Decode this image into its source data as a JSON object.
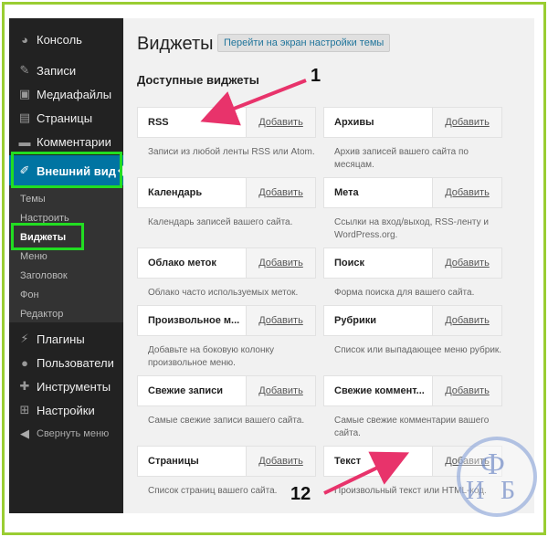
{
  "sidebar": {
    "items": [
      {
        "label": "Консоль",
        "icon": "dashboard-icon"
      },
      {
        "label": "Записи",
        "icon": "pin-icon"
      },
      {
        "label": "Медиафайлы",
        "icon": "media-icon"
      },
      {
        "label": "Страницы",
        "icon": "page-icon"
      },
      {
        "label": "Комментарии",
        "icon": "comment-icon"
      },
      {
        "label": "Внешний вид",
        "icon": "brush-icon"
      },
      {
        "label": "Плагины",
        "icon": "plugin-icon"
      },
      {
        "label": "Пользователи",
        "icon": "users-icon"
      },
      {
        "label": "Инструменты",
        "icon": "wrench-icon"
      },
      {
        "label": "Настройки",
        "icon": "settings-icon"
      }
    ],
    "submenu": [
      "Темы",
      "Настроить",
      "Виджеты",
      "Меню",
      "Заголовок",
      "Фон",
      "Редактор"
    ],
    "collapse_label": "Свернуть меню"
  },
  "main": {
    "title": "Виджеты",
    "title_action": "Перейти на экран настройки темы",
    "section_title": "Доступные виджеты",
    "add_label": "Добавить",
    "widgets": [
      {
        "name": "RSS",
        "desc": "Записи из любой ленты RSS или Atom."
      },
      {
        "name": "Архивы",
        "desc": "Архив записей вашего сайта по месяцам."
      },
      {
        "name": "Календарь",
        "desc": "Календарь записей вашего сайта."
      },
      {
        "name": "Мета",
        "desc": "Ссылки на вход/выход, RSS-ленту и WordPress.org."
      },
      {
        "name": "Облако меток",
        "desc": "Облако часто используемых меток."
      },
      {
        "name": "Поиск",
        "desc": "Форма поиска для вашего сайта."
      },
      {
        "name": "Произвольное м...",
        "desc": "Добавьте на боковую колонку произвольное меню."
      },
      {
        "name": "Рубрики",
        "desc": "Список или выпадающее меню рубрик."
      },
      {
        "name": "Свежие записи",
        "desc": "Самые свежие записи вашего сайта."
      },
      {
        "name": "Свежие коммент...",
        "desc": "Самые свежие комментарии вашего сайта."
      },
      {
        "name": "Страницы",
        "desc": "Список страниц вашего сайта."
      },
      {
        "name": "Текст",
        "desc": "Произвольный текст или HTML-код."
      }
    ]
  },
  "annotations": {
    "first": "1",
    "last": "12",
    "arrow_color": "#e8336b",
    "highlight_color": "#22dd22"
  },
  "logo": {
    "letter1": "Ф",
    "letter2": "И",
    "letter3": "Б"
  }
}
